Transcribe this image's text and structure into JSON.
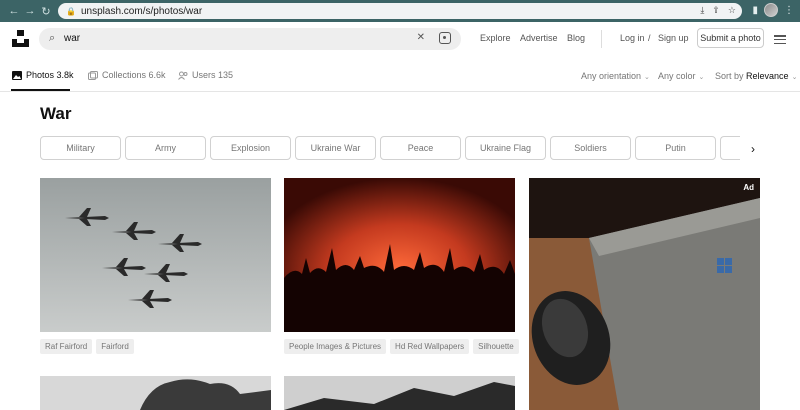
{
  "browser": {
    "url": "unsplash.com/s/photos/war"
  },
  "search": {
    "query": "war"
  },
  "topnav": {
    "explore": "Explore",
    "advertise": "Advertise",
    "blog": "Blog",
    "login": "Log in",
    "slash": "/",
    "signup": "Sign up",
    "submit": "Submit a photo"
  },
  "tabs": {
    "photos": "Photos 3.8k",
    "collections": "Collections 6.6k",
    "users": "Users 135"
  },
  "filters": {
    "orientation": "Any orientation",
    "color": "Any color",
    "sort_prefix": "Sort by",
    "sort_value": "Relevance"
  },
  "page_title": "War",
  "related": [
    "Military",
    "Army",
    "Explosion",
    "Ukraine War",
    "Peace",
    "Ukraine Flag",
    "Soldiers",
    "Putin"
  ],
  "photos": {
    "col1_tags": [
      "Raf Fairford",
      "Fairford"
    ],
    "col2_tags": [
      "People Images & Pictures",
      "Hd Red Wallpapers",
      "Silhouette"
    ],
    "ad_label": "Ad"
  },
  "colors": {
    "browser_chrome": "#3c6466",
    "search_bg": "#eeeeee",
    "fire_red": "#c43a1f"
  }
}
